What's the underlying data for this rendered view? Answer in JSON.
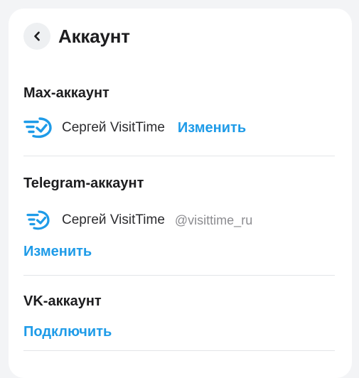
{
  "header": {
    "title": "Аккаунт",
    "back_icon": "chevron-left-icon"
  },
  "max": {
    "title": "Max-аккаунт",
    "account_name": "Сергей VisitTime",
    "change_label": "Изменить",
    "logo_icon": "visittime-logo-icon"
  },
  "telegram": {
    "title": "Telegram-аккаунт",
    "account_name": "Сергей VisitTime",
    "handle": "@visittime_ru",
    "change_label": "Изменить",
    "logo_icon": "visittime-logo-icon"
  },
  "vk": {
    "title": "VK-аккаунт",
    "connect_label": "Подключить"
  },
  "colors": {
    "accent": "#1e9be8",
    "text": "#1d1d1f",
    "muted": "#8c8c90",
    "divider": "#e3e5e8"
  }
}
